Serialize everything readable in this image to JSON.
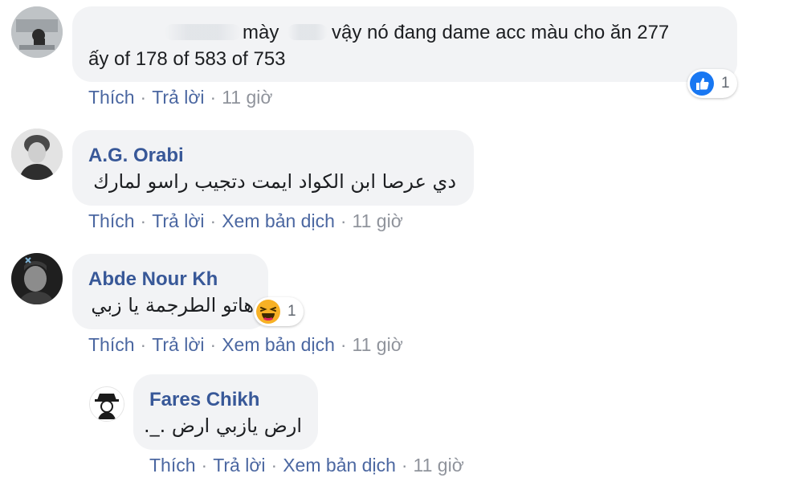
{
  "comments": [
    {
      "author": "",
      "line1_a": "mày",
      "line1_b": "vậy nó đang dame acc màu cho ăn 277",
      "line2": "ấy of 178 of 583 of 753",
      "actions": {
        "like": "Thích",
        "reply": "Trả lời",
        "time": "11 giờ"
      },
      "reaction": {
        "icon": "like-icon",
        "count": "1",
        "color": "#1877f2"
      }
    },
    {
      "author": "A.G. Orabi",
      "text": "دي عرصا ابن الكواد ايمت دتجيب راسو لمارك",
      "actions": {
        "like": "Thích",
        "reply": "Trả lời",
        "translate": "Xem bản dịch",
        "time": "11 giờ"
      }
    },
    {
      "author": "Abde Nour Kh",
      "text": "هاتو الطرجمة يا زبي",
      "actions": {
        "like": "Thích",
        "reply": "Trả lời",
        "translate": "Xem bản dịch",
        "time": "11 giờ"
      },
      "reaction": {
        "icon": "haha-icon",
        "count": "1",
        "color": "#f7b125"
      }
    },
    {
      "author": "Fares Chikh",
      "text": "ارض يازبي ارض ._.",
      "actions": {
        "like": "Thích",
        "reply": "Trả lời",
        "translate": "Xem bản dịch",
        "time": "11 giờ"
      }
    }
  ],
  "separator": "·"
}
